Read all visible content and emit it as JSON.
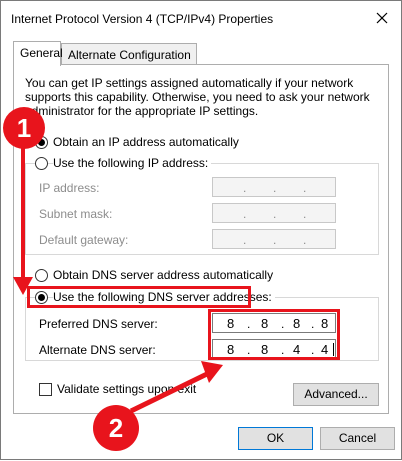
{
  "window": {
    "title": "Internet Protocol Version 4 (TCP/IPv4) Properties",
    "close_glyph": "✕"
  },
  "tabs": [
    {
      "label": "General",
      "active": true
    },
    {
      "label": "Alternate Configuration",
      "active": false
    }
  ],
  "description": "You can get IP settings assigned automatically if your network supports this capability. Otherwise, you need to ask your network administrator for the appropriate IP settings.",
  "ip_section": {
    "auto_label": "Obtain an IP address automatically",
    "manual_label": "Use the following IP address:",
    "selected": "auto",
    "fields": [
      {
        "label": "IP address:",
        "value": " .  .  . "
      },
      {
        "label": "Subnet mask:",
        "value": " .  .  . "
      },
      {
        "label": "Default gateway:",
        "value": " .  .  . "
      }
    ]
  },
  "dns_section": {
    "auto_label": "Obtain DNS server address automatically",
    "manual_label": "Use the following DNS server addresses:",
    "selected": "manual",
    "preferred_label": "Preferred DNS server:",
    "preferred_octets": [
      "8",
      "8",
      "8",
      "8"
    ],
    "alternate_label": "Alternate DNS server:",
    "alternate_octets": [
      "8",
      "8",
      "4",
      "4"
    ]
  },
  "validate_label": "Validate settings upon exit",
  "validate_checked": false,
  "buttons": {
    "advanced": "Advanced...",
    "ok": "OK",
    "cancel": "Cancel"
  },
  "annotations": {
    "step1": "1",
    "step2": "2",
    "highlight_color": "#e8141c"
  }
}
